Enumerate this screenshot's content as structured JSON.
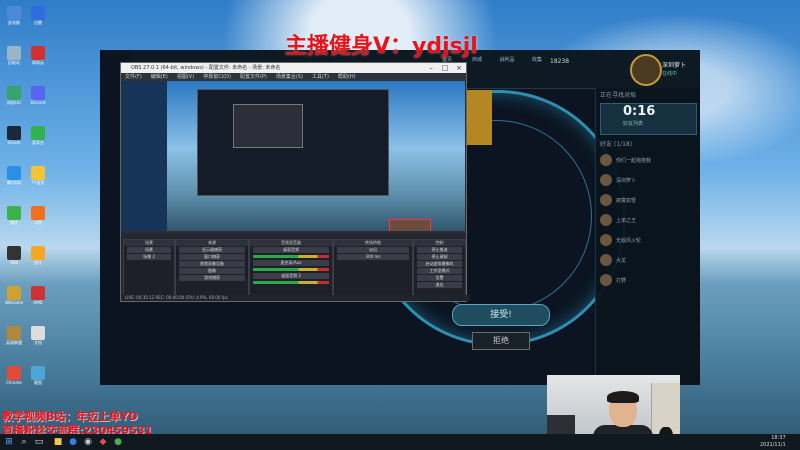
{
  "watermark_top": "主播健身V：ydjsjl",
  "overlay_bottom": {
    "line1": "教学视频B站：年迈上单YD",
    "line2": "直播粉丝交流群:230459531"
  },
  "desktop_icons": [
    {
      "label": "此电脑",
      "color": "#4b8ad8"
    },
    {
      "label": "回收站",
      "color": "#9ab4c8"
    },
    {
      "label": "网易UU",
      "color": "#38a36b"
    },
    {
      "label": "Steam",
      "color": "#1b2838"
    },
    {
      "label": "腾讯QQ",
      "color": "#2d8fe3"
    },
    {
      "label": "微信",
      "color": "#3cb34a"
    },
    {
      "label": "OBS",
      "color": "#333"
    },
    {
      "label": "WeGame",
      "color": "#d0a030"
    },
    {
      "label": "英雄联盟",
      "color": "#b08a3a"
    },
    {
      "label": "Chrome",
      "color": "#e04b3a"
    },
    {
      "label": "迅雷",
      "color": "#2d6de0"
    },
    {
      "label": "网易云",
      "color": "#d03030"
    },
    {
      "label": "Discord",
      "color": "#5865f2"
    },
    {
      "label": "爱奇艺",
      "color": "#34b04c"
    },
    {
      "label": "YY语音",
      "color": "#f2c533"
    },
    {
      "label": "斗鱼",
      "color": "#f07020"
    },
    {
      "label": "虎牙",
      "color": "#f5a623"
    },
    {
      "label": "AMD",
      "color": "#c33"
    },
    {
      "label": "文档",
      "color": "#ddd"
    },
    {
      "label": "截图",
      "color": "#4da6d8"
    }
  ],
  "game": {
    "timer": "0:16",
    "profile_name": "深圳萝卜",
    "profile_status": "在线中",
    "coins": "18238",
    "accept_label": "接受!",
    "decline_label": "拒绝",
    "panel_header": "正在寻找对局",
    "panel_sub": "好友列表",
    "friends_count": "好友 (1/18)",
    "members": [
      "你们一起抱抱我",
      "深圳萝卜",
      "寂寞如雪",
      "上单之王",
      "无敌风火轮",
      "大龙",
      "打野"
    ],
    "nav": [
      "首页",
      "商城",
      "战利品",
      "收集",
      "生涯",
      "个人"
    ]
  },
  "obs": {
    "title": "OBS 27.0.1 (64-bit, windows) - 配置文件: 未命名 - 场景: 未命名",
    "menus": [
      "文件(F)",
      "编辑(E)",
      "视图(V)",
      "停靠窗口(D)",
      "配置文件(P)",
      "场景集合(S)",
      "工具(T)",
      "帮助(H)"
    ],
    "docks": {
      "scenes_title": "场景",
      "sources_title": "来源",
      "mixer_title": "音频混音器",
      "transitions_title": "转场特效",
      "controls_title": "控制"
    },
    "scenes": [
      "场景",
      "场景 2"
    ],
    "sources": [
      "显示器捕获",
      "窗口捕获",
      "视频采集设备",
      "图像",
      "游戏捕获"
    ],
    "mixer": [
      "桌面音频",
      "麦克风/Aux",
      "桌面音频 2"
    ],
    "transition": "淡出",
    "duration": "300 ms",
    "controls": [
      "停止推流",
      "停止录制",
      "启动虚拟摄像机",
      "工作室模式",
      "设置",
      "退出"
    ],
    "status": "LIVE: 00:35:12   REC: 00:00:00   CPU: 4.9%, 60.00 fps"
  },
  "taskbar": {
    "time": "18:37",
    "date": "2021/11/1"
  }
}
